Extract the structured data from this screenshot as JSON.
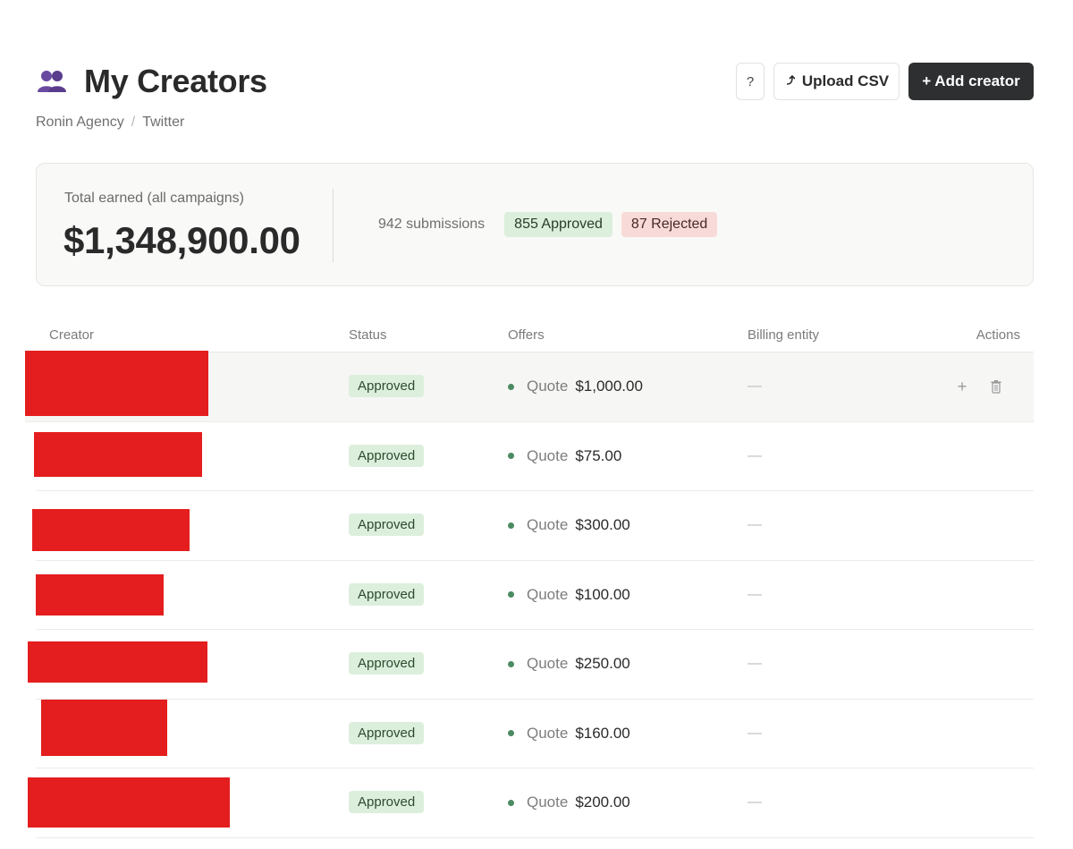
{
  "header": {
    "title": "My Creators",
    "icon": "people-icon",
    "breadcrumb": [
      "Ronin Agency",
      "Twitter"
    ],
    "breadcrumb_sep": "/"
  },
  "toolbar": {
    "help_label": "?",
    "upload_icon": "upload-icon",
    "upload_label": "Upload CSV",
    "add_label": "+ Add creator"
  },
  "summary": {
    "label": "Total earned (all campaigns)",
    "total": "$1,348,900.00",
    "submissions": "942 submissions",
    "approved": "855 Approved",
    "rejected": "87 Rejected"
  },
  "table": {
    "columns": {
      "creator": "Creator",
      "status": "Status",
      "offers": "Offers",
      "billing": "Billing entity",
      "actions": "Actions"
    },
    "rows": [
      {
        "status": "Approved",
        "quote_label": "Quote",
        "amount": "$1,000.00",
        "billing": "—",
        "hovered": true
      },
      {
        "status": "Approved",
        "quote_label": "Quote",
        "amount": "$75.00",
        "billing": "—"
      },
      {
        "status": "Approved",
        "quote_label": "Quote",
        "amount": "$300.00",
        "billing": "—"
      },
      {
        "status": "Approved",
        "quote_label": "Quote",
        "amount": "$100.00",
        "billing": "—"
      },
      {
        "status": "Approved",
        "quote_label": "Quote",
        "amount": "$250.00",
        "billing": "—"
      },
      {
        "status": "Approved",
        "quote_label": "Quote",
        "amount": "$160.00",
        "billing": "—"
      },
      {
        "status": "Approved",
        "quote_label": "Quote",
        "amount": "$200.00",
        "billing": "—"
      }
    ],
    "row_action_add": "+"
  },
  "colors": {
    "primary_button": "#2d2f30",
    "approved_bg": "#dcefdd",
    "rejected_bg": "#f8dbd8",
    "status_dot": "#4b8a62",
    "redaction": "#e41e1e"
  }
}
